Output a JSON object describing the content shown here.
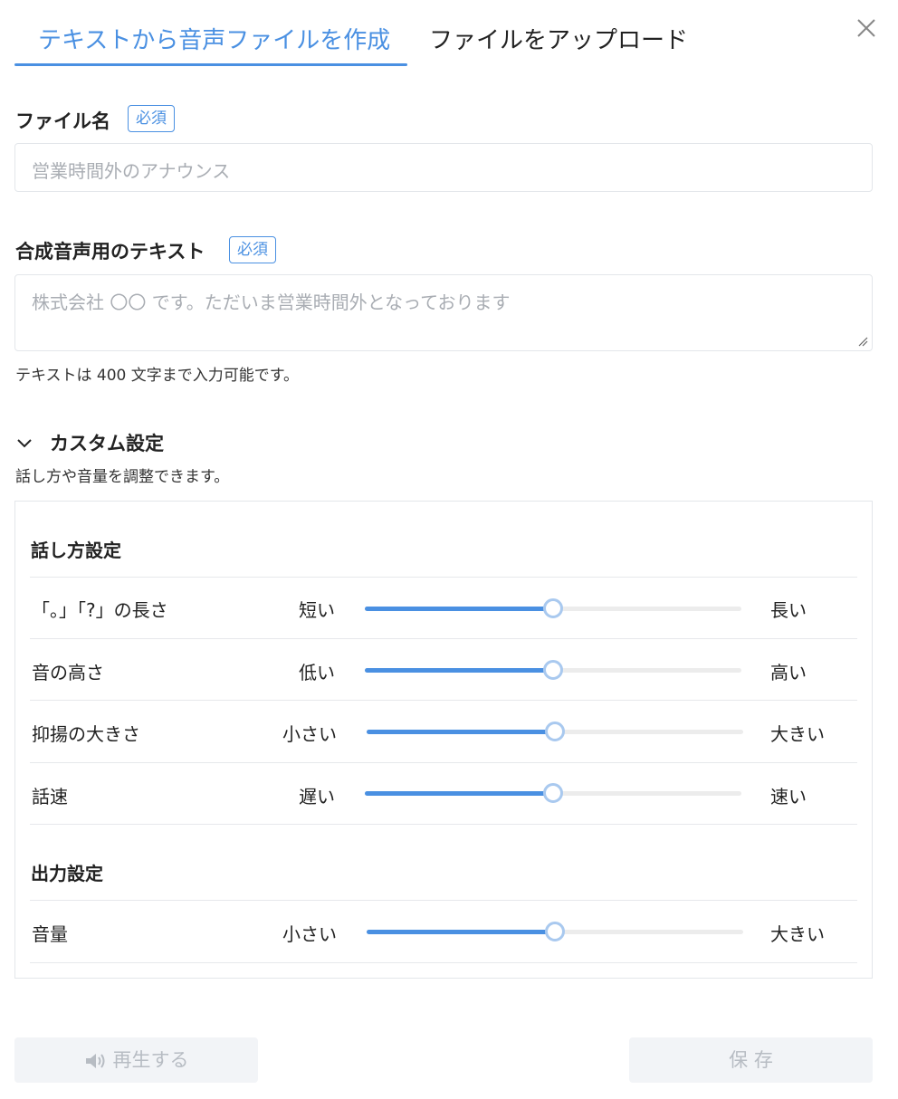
{
  "tabs": [
    {
      "label": "テキストから音声ファイルを作成",
      "active": true
    },
    {
      "label": "ファイルをアップロード",
      "active": false
    }
  ],
  "close_icon": "close-icon",
  "filename": {
    "label": "ファイル名",
    "required_badge": "必須",
    "placeholder": "営業時間外のアナウンス",
    "value": ""
  },
  "tts_text": {
    "label": "合成音声用のテキスト",
    "required_badge": "必須",
    "placeholder": "株式会社 〇〇 です。ただいま営業時間外となっております",
    "value": "",
    "hint": "テキストは 400 文字まで入力可能です。"
  },
  "custom": {
    "toggle_icon": "chevron-down-icon",
    "title": "カスタム設定",
    "description": "話し方や音量を調整できます。",
    "speech_group": {
      "title": "話し方設定",
      "rows": [
        {
          "label": "「。」「?」の長さ",
          "min": "短い",
          "max": "長い",
          "value": 0.5
        },
        {
          "label": "音の高さ",
          "min": "低い",
          "max": "高い",
          "value": 0.5
        },
        {
          "label": "抑揚の大きさ",
          "min": "小さい",
          "max": "大きい",
          "value": 0.5
        },
        {
          "label": "話速",
          "min": "遅い",
          "max": "速い",
          "value": 0.5
        }
      ]
    },
    "output_group": {
      "title": "出力設定",
      "rows": [
        {
          "label": "音量",
          "min": "小さい",
          "max": "大きい",
          "value": 0.5
        }
      ]
    }
  },
  "actions": {
    "play_icon": "speaker-icon",
    "play_label": "再生する",
    "save_label": "保 存"
  },
  "colors": {
    "accent": "#4a90e2",
    "disabled_bg": "#f2f4f7",
    "disabled_text": "#b7bcc3"
  }
}
